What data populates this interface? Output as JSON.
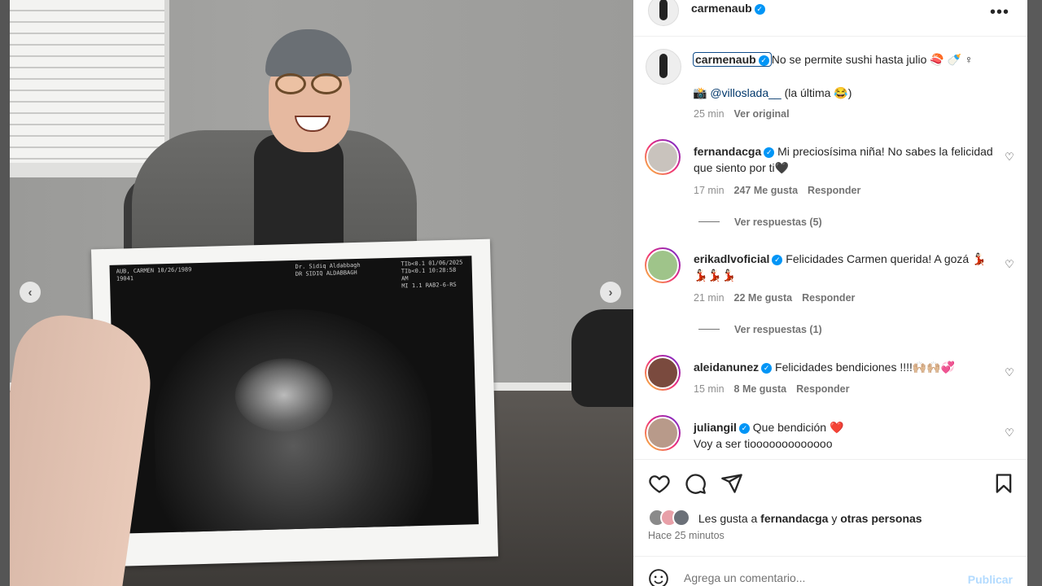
{
  "post": {
    "author": "carmenaub",
    "more_icon": "more-horizontal-icon"
  },
  "ultrasound": {
    "header_left_1": "AUB, CARMEN  10/26/1989",
    "header_left_2": "19041",
    "header_mid_1": "Dr. Sidiq Aldabbagh",
    "header_mid_2": "DR SIDIQ ALDABBAGH",
    "header_right_1": "TIb<0.1  01/06/2025",
    "header_right_2": "TIb<0.1  10:28:58 AM",
    "header_right_3": "MI 1.1    RAB2-6-RS"
  },
  "caption": {
    "username": "carmenaub",
    "text": "No se permite sushi hasta julio 🍣 🍼 ♀",
    "line2_prefix": "📸",
    "mention": "@villoslada__",
    "line2_suffix": "(la última 😂)",
    "time": "25 min",
    "translate": "Ver original"
  },
  "comments": [
    {
      "username": "fernandacga",
      "text": "Mi preciosísima niña! No sabes la felicidad que siento por ti🖤",
      "time": "17 min",
      "likes": "247 Me gusta",
      "reply": "Responder",
      "view_replies": "Ver respuestas (5)",
      "avatar_color": "#c9c3bd"
    },
    {
      "username": "erikadlvoficial",
      "text": "Felicidades Carmen querida! A gozá 💃🏻💃🏻💃🏻💃🏻",
      "time": "21 min",
      "likes": "22 Me gusta",
      "reply": "Responder",
      "view_replies": "Ver respuestas (1)",
      "avatar_color": "#9fc48a"
    },
    {
      "username": "aleidanunez",
      "text": "Felicidades bendiciones !!!!🙌🏼🙌🏼💞",
      "time": "15 min",
      "likes": "8 Me gusta",
      "reply": "Responder",
      "avatar_color": "#7a4a3e"
    },
    {
      "username": "juliangil",
      "text": "Que bendición ❤️",
      "text2": "Voy a ser tiooooooooooooo",
      "avatar_color": "#b89a8a"
    }
  ],
  "actions": {
    "like_icon": "heart-icon",
    "comment_icon": "comment-icon",
    "share_icon": "send-icon",
    "save_icon": "bookmark-icon"
  },
  "likes_summary": {
    "prefix": "Les gusta a",
    "user": "fernandacga",
    "connector": "y",
    "others": "otras personas"
  },
  "posted_time": "Hace 25 minutos",
  "comment_input": {
    "placeholder": "Agrega un comentario...",
    "publish_label": "Publicar",
    "emoji_icon": "emoji-icon"
  },
  "carousel": {
    "prev_icon": "chevron-left-icon",
    "next_icon": "chevron-right-icon"
  }
}
